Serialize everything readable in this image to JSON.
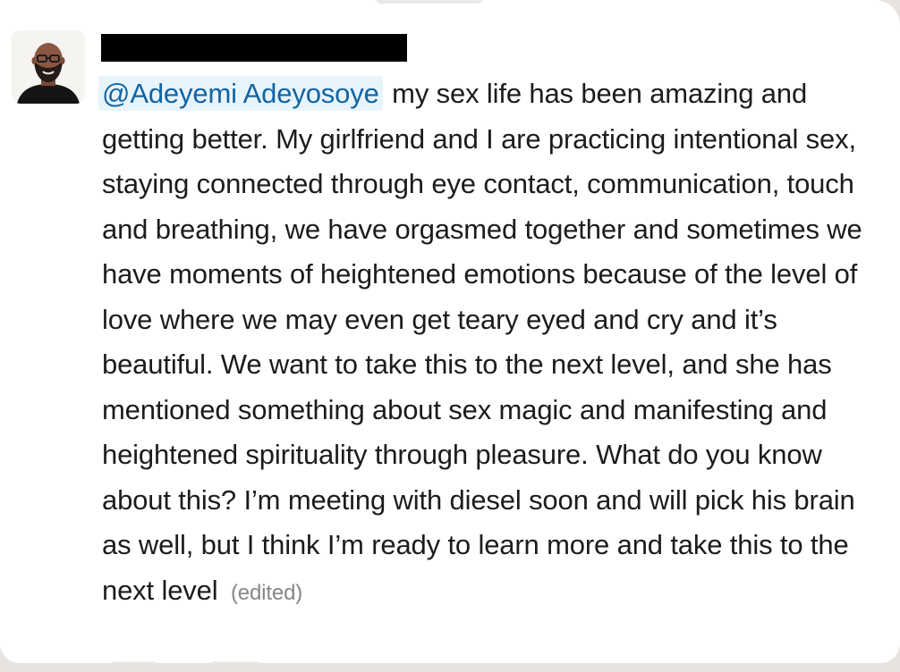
{
  "message": {
    "mention": "@Adeyemi Adeyosoye",
    "text": "my sex life has been amazing and getting better.  My girlfriend and I are practicing intentional sex, staying connected through eye contact, communication, touch and breathing, we have orgasmed together and sometimes we have moments of heightened emotions because of the level of love where we may even get teary eyed and cry and it’s beautiful. We want to take this to the next level, and she has mentioned something about sex magic and manifesting and heightened spirituality through pleasure. What do you know about this? I’m meeting with diesel soon and will pick his brain as well, but I think I’m ready to learn more and take this to the next level",
    "edited_label": "(edited)"
  },
  "colors": {
    "mention_bg": "#e8f4fb",
    "mention_text": "#1264a3",
    "body_text": "#1d1c1d",
    "muted_text": "#868686"
  }
}
